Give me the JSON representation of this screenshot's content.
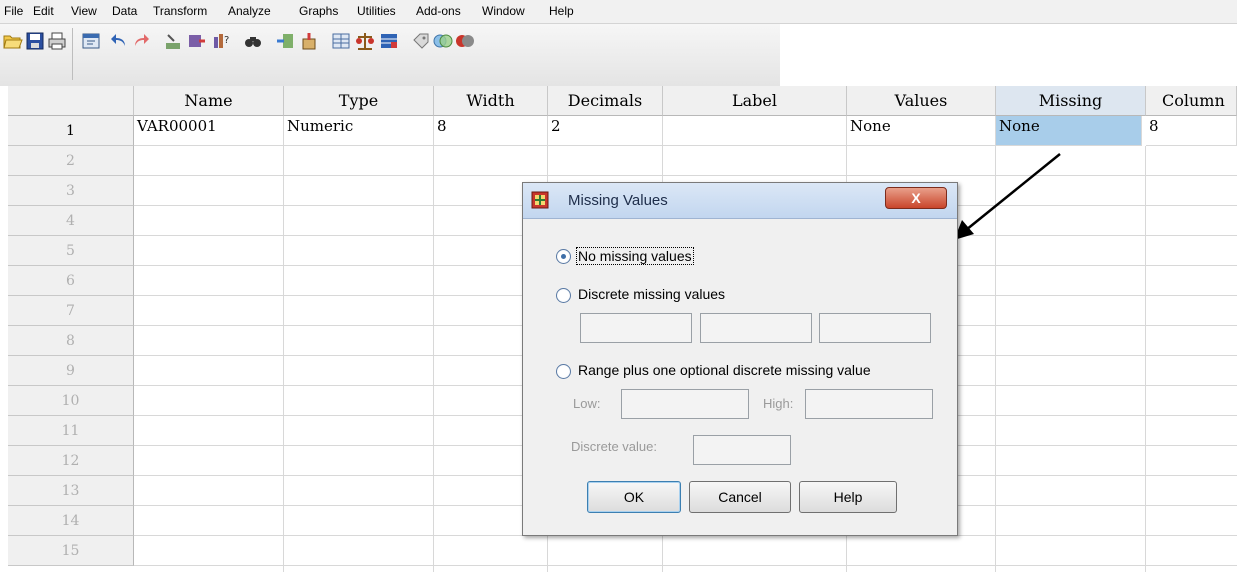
{
  "menu": [
    {
      "label": "File"
    },
    {
      "label": "Edit"
    },
    {
      "label": "View"
    },
    {
      "label": "Data"
    },
    {
      "label": "Transform"
    },
    {
      "label": "Analyze"
    },
    {
      "label": "Graphs"
    },
    {
      "label": "Utilities"
    },
    {
      "label": "Add-ons"
    },
    {
      "label": "Window"
    },
    {
      "label": "Help"
    }
  ],
  "toolbar_icons": [
    "open-icon",
    "save-icon",
    "print-icon",
    "dialog-recall-icon",
    "undo-icon",
    "redo-icon",
    "goto-case-icon",
    "goto-variable-icon",
    "variables-icon",
    "find-icon",
    "insert-cases-icon",
    "insert-variable-icon",
    "split-file-icon",
    "weight-cases-icon",
    "select-cases-icon",
    "value-labels-icon",
    "use-sets-icon",
    "show-all-variables-icon"
  ],
  "grid": {
    "columns": [
      "Name",
      "Type",
      "Width",
      "Decimals",
      "Label",
      "Values",
      "Missing",
      "Column"
    ],
    "row_numbers": [
      "1",
      "2",
      "3",
      "4",
      "5",
      "6",
      "7",
      "8",
      "9",
      "10",
      "11",
      "12",
      "13",
      "14",
      "15"
    ],
    "row1": {
      "name": "VAR00001",
      "type": "Numeric",
      "width": "8",
      "decimals": "2",
      "label": "",
      "values": "None",
      "missing": "None",
      "column": "8"
    }
  },
  "dialog": {
    "title": "Missing Values",
    "close_label": "X",
    "options": {
      "no_missing": "No missing values",
      "discrete": "Discrete missing values",
      "range": "Range plus one optional discrete missing value"
    },
    "selected_option": "no_missing",
    "low_label": "Low:",
    "high_label": "High:",
    "discrete_value_label": "Discrete value:",
    "buttons": {
      "ok": "OK",
      "cancel": "Cancel",
      "help": "Help"
    }
  },
  "colors": {
    "selected_cell": "#a8cdea",
    "title_bar": "#c2d6ef",
    "close_button": "#c9452b"
  }
}
